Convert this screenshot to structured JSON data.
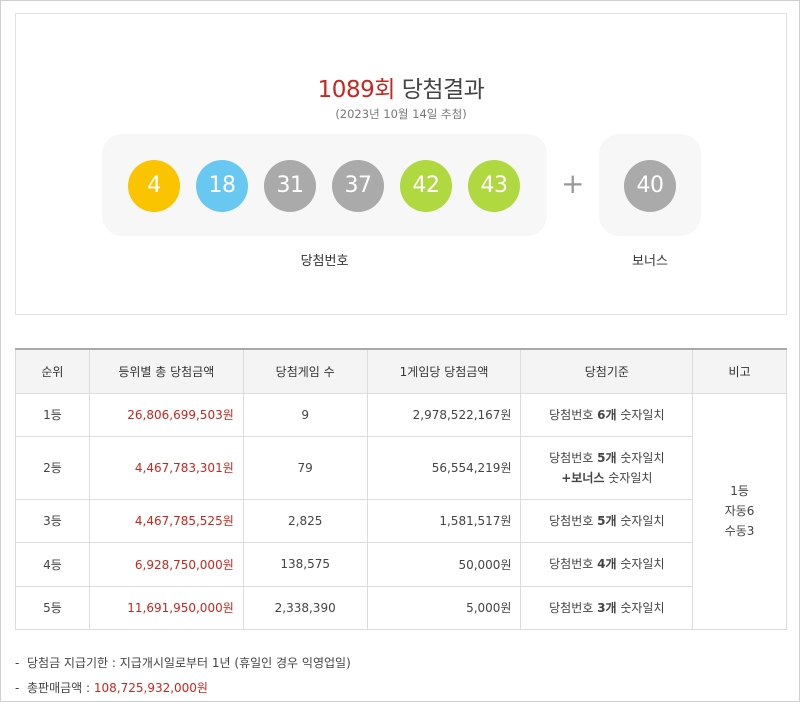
{
  "header": {
    "round": "1089회",
    "title_rest": "당첨결과",
    "draw_date": "(2023년 10월 14일 추첨)"
  },
  "balls": [
    {
      "number": "4",
      "color": "#fbc400"
    },
    {
      "number": "18",
      "color": "#69c8f2"
    },
    {
      "number": "31",
      "color": "#aaaaaa"
    },
    {
      "number": "37",
      "color": "#aaaaaa"
    },
    {
      "number": "42",
      "color": "#b0d840"
    },
    {
      "number": "43",
      "color": "#b0d840"
    }
  ],
  "plus": "+",
  "bonus": {
    "number": "40",
    "color": "#aaaaaa"
  },
  "labels": {
    "main": "당첨번호",
    "bonus": "보너스"
  },
  "table": {
    "headers": [
      "순위",
      "등위별 총 당첨금액",
      "당첨게임 수",
      "1게임당 당첨금액",
      "당첨기준",
      "비고"
    ],
    "rows": [
      {
        "rank": "1등",
        "total": "26,806,699,503원",
        "count": "9",
        "per_game": "2,978,522,167원",
        "crit_pre": "당첨번호 ",
        "crit_bold": "6개",
        "crit_post": " 숫자일치",
        "crit2_bold": "",
        "crit2_post": ""
      },
      {
        "rank": "2등",
        "total": "4,467,783,301원",
        "count": "79",
        "per_game": "56,554,219원",
        "crit_pre": "당첨번호 ",
        "crit_bold": "5개",
        "crit_post": " 숫자일치",
        "crit2_bold": "+보너스",
        "crit2_post": " 숫자일치"
      },
      {
        "rank": "3등",
        "total": "4,467,785,525원",
        "count": "2,825",
        "per_game": "1,581,517원",
        "crit_pre": "당첨번호 ",
        "crit_bold": "5개",
        "crit_post": " 숫자일치",
        "crit2_bold": "",
        "crit2_post": ""
      },
      {
        "rank": "4등",
        "total": "6,928,750,000원",
        "count": "138,575",
        "per_game": "50,000원",
        "crit_pre": "당첨번호 ",
        "crit_bold": "4개",
        "crit_post": " 숫자일치",
        "crit2_bold": "",
        "crit2_post": ""
      },
      {
        "rank": "5등",
        "total": "11,691,950,000원",
        "count": "2,338,390",
        "per_game": "5,000원",
        "crit_pre": "당첨번호 ",
        "crit_bold": "3개",
        "crit_post": " 숫자일치",
        "crit2_bold": "",
        "crit2_post": ""
      }
    ],
    "note": {
      "line1": "1등",
      "line2": "자동6",
      "line3": "수동3"
    }
  },
  "footnotes": {
    "dash": "-",
    "deadline": "당첨금 지급기한 : 지급개시일로부터 1년 (휴일인 경우 익영업일)",
    "sales_label": "총판매금액 : ",
    "sales_value": "108,725,932,000원"
  }
}
